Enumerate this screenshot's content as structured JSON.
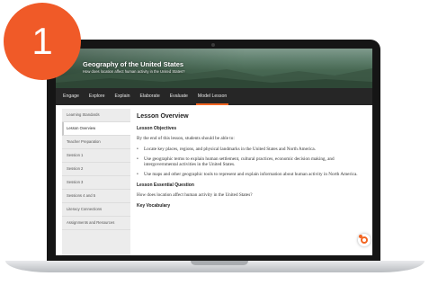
{
  "badge": {
    "number": "1"
  },
  "hero": {
    "title": "Geography of the United States",
    "subtitle": "How does location affect human activity in the United States?"
  },
  "nav": {
    "tabs": [
      {
        "label": "Engage"
      },
      {
        "label": "Explore"
      },
      {
        "label": "Explain"
      },
      {
        "label": "Elaborate"
      },
      {
        "label": "Evaluate"
      },
      {
        "label": "Model Lesson",
        "active": true
      }
    ]
  },
  "sidebar": {
    "items": [
      {
        "label": "Learning Standards"
      },
      {
        "label": "Lesson Overview",
        "active": true
      },
      {
        "label": "Teacher Preparation"
      },
      {
        "label": "Session 1"
      },
      {
        "label": "Session 2"
      },
      {
        "label": "Session 3"
      },
      {
        "label": "Sessions 4 and 5"
      },
      {
        "label": "Literacy Connections"
      },
      {
        "label": "Assignments and Resources"
      }
    ]
  },
  "content": {
    "heading": "Lesson Overview",
    "objectives_heading": "Lesson Objectives",
    "objectives_intro": "By the end of this lesson, students should be able to:",
    "objectives": [
      "Locate key places, regions, and physical landmarks in the United States and North America.",
      "Use geographic terms to explain human settlement, cultural practices, economic decision making, and intergovernmental activities in the United States.",
      "Use maps and other geographic tools to represent and explain information about human activity in North America."
    ],
    "question_heading": "Lesson Essential Question",
    "question": "How does location affect human activity in the United States?",
    "vocab_heading": "Key Vocabulary"
  },
  "colors": {
    "accent": "#f05a28",
    "nav_bg": "#262626",
    "sidebar_bg": "#ececec"
  }
}
